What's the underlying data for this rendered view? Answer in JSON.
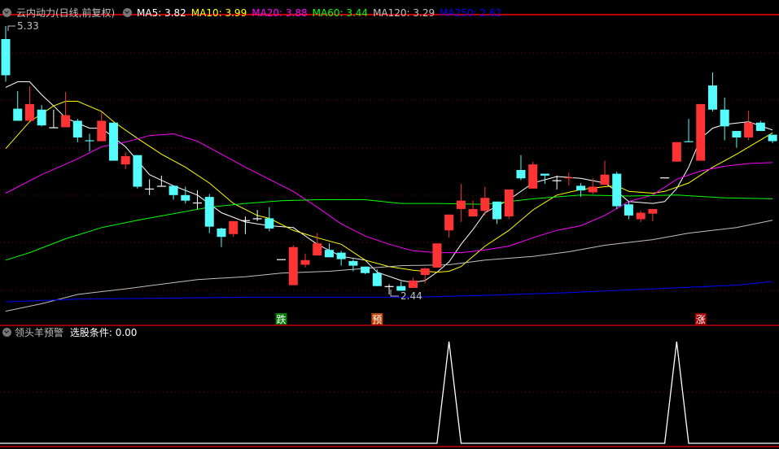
{
  "header": {
    "title": "云内动力(日线,前复权)",
    "ma_labels": [
      {
        "text": "MA5: 3.82",
        "color": "#ffffff"
      },
      {
        "text": "MA10: 3.99",
        "color": "#ffff00"
      },
      {
        "text": "MA20: 3.88",
        "color": "#ff00ff"
      },
      {
        "text": "MA60: 3.44",
        "color": "#00ff00"
      },
      {
        "text": "MA120: 3.29",
        "color": "#c0c0c0"
      },
      {
        "text": "MA250: 2.62",
        "color": "#0000ff"
      }
    ]
  },
  "indicator": {
    "name": "领头羊预警",
    "value_label": "选股条件: 0.00"
  },
  "chart_data": [
    {
      "type": "candlestick",
      "title": "云内动力(日线,前复权)",
      "price_range": [
        2.44,
        5.33
      ],
      "annotations": {
        "max_label": "5.33",
        "min_label": "2.44"
      },
      "colors": {
        "up": "#ff3333",
        "down": "#54fcfc",
        "doji": "#ffffff"
      },
      "ohlc": [
        [
          5.19,
          5.33,
          4.73,
          4.8
        ],
        [
          4.44,
          4.63,
          4.31,
          4.31
        ],
        [
          4.31,
          4.68,
          4.31,
          4.49
        ],
        [
          4.43,
          4.48,
          4.25,
          4.26
        ],
        [
          4.24,
          4.43,
          4.24,
          4.24
        ],
        [
          4.24,
          4.62,
          4.24,
          4.37
        ],
        [
          4.31,
          4.33,
          4.08,
          4.13
        ],
        [
          4.1,
          4.17,
          3.98,
          4.09
        ],
        [
          4.09,
          4.4,
          4.09,
          4.31
        ],
        [
          4.29,
          4.29,
          3.88,
          3.88
        ],
        [
          3.84,
          3.97,
          3.79,
          3.93
        ],
        [
          3.94,
          3.94,
          3.58,
          3.6
        ],
        [
          3.58,
          3.68,
          3.51,
          3.58
        ],
        [
          3.61,
          3.72,
          3.61,
          3.61
        ],
        [
          3.61,
          3.61,
          3.46,
          3.51
        ],
        [
          3.51,
          3.6,
          3.42,
          3.45
        ],
        [
          3.43,
          3.56,
          3.36,
          3.43
        ],
        [
          3.49,
          3.52,
          3.1,
          3.17
        ],
        [
          3.15,
          3.16,
          2.95,
          3.06
        ],
        [
          3.09,
          3.23,
          3.06,
          3.23
        ],
        [
          3.24,
          3.28,
          3.09,
          3.24
        ],
        [
          3.26,
          3.35,
          3.23,
          3.26
        ],
        [
          3.26,
          3.38,
          3.12,
          3.15
        ],
        [
          2.82,
          2.82,
          2.82,
          2.82
        ],
        [
          2.54,
          2.97,
          2.54,
          2.95
        ],
        [
          2.76,
          2.88,
          2.73,
          2.81
        ],
        [
          2.86,
          3.1,
          2.86,
          2.99
        ],
        [
          2.92,
          2.99,
          2.84,
          2.84
        ],
        [
          2.89,
          2.91,
          2.75,
          2.82
        ],
        [
          2.8,
          2.82,
          2.69,
          2.75
        ],
        [
          2.74,
          2.74,
          2.66,
          2.67
        ],
        [
          2.67,
          2.71,
          2.53,
          2.53
        ],
        [
          2.53,
          2.55,
          2.44,
          2.53
        ],
        [
          2.53,
          2.58,
          2.48,
          2.48
        ],
        [
          2.51,
          2.62,
          2.51,
          2.59
        ],
        [
          2.65,
          2.73,
          2.56,
          2.72
        ],
        [
          2.73,
          2.99,
          2.73,
          2.99
        ],
        [
          3.13,
          3.3,
          3.05,
          3.3
        ],
        [
          3.36,
          3.63,
          3.22,
          3.45
        ],
        [
          3.28,
          3.45,
          3.28,
          3.36
        ],
        [
          3.34,
          3.6,
          3.29,
          3.48
        ],
        [
          3.44,
          3.44,
          3.2,
          3.25
        ],
        [
          3.28,
          3.57,
          3.25,
          3.57
        ],
        [
          3.78,
          3.94,
          3.67,
          3.69
        ],
        [
          3.58,
          3.87,
          3.58,
          3.84
        ],
        [
          3.74,
          3.74,
          3.63,
          3.72
        ],
        [
          3.67,
          3.72,
          3.57,
          3.67
        ],
        [
          3.69,
          3.75,
          3.61,
          3.7
        ],
        [
          3.61,
          3.64,
          3.49,
          3.56
        ],
        [
          3.54,
          3.69,
          3.52,
          3.6
        ],
        [
          3.62,
          3.88,
          3.62,
          3.73
        ],
        [
          3.74,
          3.76,
          3.36,
          3.39
        ],
        [
          3.41,
          3.45,
          3.25,
          3.29
        ],
        [
          3.25,
          3.34,
          3.22,
          3.32
        ],
        [
          3.31,
          3.36,
          3.23,
          3.36
        ],
        [
          3.7,
          3.7,
          3.7,
          3.7
        ],
        [
          3.87,
          4.08,
          3.87,
          4.08
        ],
        [
          4.09,
          4.33,
          4.08,
          4.08
        ],
        [
          3.88,
          4.49,
          3.88,
          4.49
        ],
        [
          4.69,
          4.83,
          4.41,
          4.43
        ],
        [
          4.43,
          4.56,
          4.1,
          4.25
        ],
        [
          4.2,
          4.2,
          4.02,
          4.13
        ],
        [
          4.13,
          4.42,
          4.1,
          4.29
        ],
        [
          4.29,
          4.31,
          4.2,
          4.2
        ],
        [
          4.16,
          4.16,
          4.07,
          4.09
        ]
      ],
      "moving_averages": [
        {
          "name": "MA5",
          "color": "#ffffff",
          "points": [
            [
              0,
              4.67
            ],
            [
              1,
              4.73
            ],
            [
              2,
              4.73
            ],
            [
              3,
              4.59
            ],
            [
              4,
              4.47
            ],
            [
              5,
              4.34
            ],
            [
              7,
              4.23
            ],
            [
              8,
              4.23
            ],
            [
              10,
              4.03
            ],
            [
              12,
              3.73
            ],
            [
              14,
              3.61
            ],
            [
              16,
              3.51
            ],
            [
              18,
              3.32
            ],
            [
              20,
              3.22
            ],
            [
              22,
              3.18
            ],
            [
              24,
              3.16
            ],
            [
              26,
              2.98
            ],
            [
              28,
              2.85
            ],
            [
              30,
              2.81
            ],
            [
              31,
              2.68
            ],
            [
              33,
              2.59
            ],
            [
              34,
              2.57
            ],
            [
              35,
              2.59
            ],
            [
              36,
              2.68
            ],
            [
              37,
              2.79
            ],
            [
              38,
              2.98
            ],
            [
              39,
              3.14
            ],
            [
              40,
              3.32
            ],
            [
              42,
              3.46
            ],
            [
              44,
              3.64
            ],
            [
              46,
              3.71
            ],
            [
              48,
              3.69
            ],
            [
              50,
              3.64
            ],
            [
              51,
              3.55
            ],
            [
              52,
              3.44
            ],
            [
              54,
              3.42
            ],
            [
              55,
              3.44
            ],
            [
              56,
              3.58
            ],
            [
              57,
              3.81
            ],
            [
              58,
              4.12
            ],
            [
              59,
              4.23
            ],
            [
              60,
              4.27
            ],
            [
              62,
              4.3
            ],
            [
              64,
              4.21
            ]
          ]
        },
        {
          "name": "MA10",
          "color": "#ffff00",
          "points": [
            [
              0,
              4.01
            ],
            [
              2,
              4.3
            ],
            [
              4,
              4.47
            ],
            [
              5,
              4.52
            ],
            [
              6,
              4.52
            ],
            [
              8,
              4.41
            ],
            [
              9,
              4.3
            ],
            [
              11,
              4.12
            ],
            [
              13,
              3.95
            ],
            [
              15,
              3.81
            ],
            [
              17,
              3.64
            ],
            [
              19,
              3.42
            ],
            [
              21,
              3.29
            ],
            [
              22,
              3.26
            ],
            [
              24,
              3.13
            ],
            [
              26,
              3.05
            ],
            [
              28,
              2.98
            ],
            [
              30,
              2.81
            ],
            [
              32,
              2.74
            ],
            [
              34,
              2.7
            ],
            [
              36,
              2.68
            ],
            [
              37,
              2.69
            ],
            [
              38,
              2.74
            ],
            [
              39,
              2.85
            ],
            [
              40,
              2.96
            ],
            [
              42,
              3.13
            ],
            [
              44,
              3.35
            ],
            [
              46,
              3.51
            ],
            [
              48,
              3.57
            ],
            [
              50,
              3.6
            ],
            [
              51,
              3.61
            ],
            [
              52,
              3.55
            ],
            [
              54,
              3.53
            ],
            [
              55,
              3.55
            ],
            [
              57,
              3.64
            ],
            [
              59,
              3.81
            ],
            [
              61,
              3.95
            ],
            [
              64,
              4.18
            ]
          ]
        },
        {
          "name": "MA20",
          "color": "#ff00ff",
          "points": [
            [
              0,
              3.53
            ],
            [
              3,
              3.73
            ],
            [
              6,
              3.9
            ],
            [
              8,
              4.03
            ],
            [
              10,
              4.08
            ],
            [
              12,
              4.15
            ],
            [
              14,
              4.17
            ],
            [
              16,
              4.09
            ],
            [
              18,
              3.95
            ],
            [
              20,
              3.81
            ],
            [
              22,
              3.68
            ],
            [
              24,
              3.55
            ],
            [
              26,
              3.38
            ],
            [
              28,
              3.2
            ],
            [
              30,
              3.07
            ],
            [
              32,
              2.98
            ],
            [
              34,
              2.91
            ],
            [
              36,
              2.89
            ],
            [
              38,
              2.89
            ],
            [
              40,
              2.92
            ],
            [
              42,
              2.96
            ],
            [
              44,
              3.05
            ],
            [
              46,
              3.13
            ],
            [
              48,
              3.18
            ],
            [
              50,
              3.29
            ],
            [
              52,
              3.44
            ],
            [
              54,
              3.51
            ],
            [
              56,
              3.68
            ],
            [
              58,
              3.77
            ],
            [
              60,
              3.82
            ],
            [
              62,
              3.85
            ],
            [
              64,
              3.86
            ]
          ]
        },
        {
          "name": "MA60",
          "color": "#00ff00",
          "points": [
            [
              0,
              2.81
            ],
            [
              2,
              2.89
            ],
            [
              5,
              3.04
            ],
            [
              8,
              3.16
            ],
            [
              11,
              3.24
            ],
            [
              14,
              3.31
            ],
            [
              17,
              3.38
            ],
            [
              20,
              3.42
            ],
            [
              23,
              3.45
            ],
            [
              26,
              3.46
            ],
            [
              30,
              3.46
            ],
            [
              33,
              3.42
            ],
            [
              36,
              3.42
            ],
            [
              40,
              3.41
            ],
            [
              44,
              3.47
            ],
            [
              48,
              3.51
            ],
            [
              52,
              3.5
            ],
            [
              56,
              3.51
            ],
            [
              60,
              3.48
            ],
            [
              64,
              3.47
            ]
          ]
        },
        {
          "name": "MA120",
          "color": "#c0c0c0",
          "points": [
            [
              0,
              2.26
            ],
            [
              3,
              2.34
            ],
            [
              6,
              2.44
            ],
            [
              10,
              2.5
            ],
            [
              13,
              2.55
            ],
            [
              16,
              2.6
            ],
            [
              20,
              2.63
            ],
            [
              23,
              2.67
            ],
            [
              27,
              2.69
            ],
            [
              30,
              2.72
            ],
            [
              33,
              2.75
            ],
            [
              37,
              2.76
            ],
            [
              40,
              2.81
            ],
            [
              44,
              2.85
            ],
            [
              47,
              2.9
            ],
            [
              50,
              2.97
            ],
            [
              54,
              3.03
            ],
            [
              57,
              3.1
            ],
            [
              61,
              3.16
            ],
            [
              64,
              3.24
            ]
          ]
        },
        {
          "name": "MA250",
          "color": "#0000ff",
          "points": [
            [
              0,
              2.36
            ],
            [
              6,
              2.39
            ],
            [
              13,
              2.4
            ],
            [
              20,
              2.41
            ],
            [
              27,
              2.41
            ],
            [
              34,
              2.41
            ],
            [
              40,
              2.43
            ],
            [
              47,
              2.46
            ],
            [
              54,
              2.5
            ],
            [
              61,
              2.54
            ],
            [
              64,
              2.58
            ]
          ]
        }
      ],
      "signals": [
        {
          "index": 23,
          "text": "跌",
          "color": "#008000"
        },
        {
          "index": 31,
          "text": "预",
          "color": "#c04000"
        },
        {
          "index": 58,
          "text": "涨",
          "color": "#a00000"
        }
      ]
    },
    {
      "type": "line",
      "title": "领头羊预警",
      "ylim": [
        0,
        1
      ],
      "series": [
        {
          "name": "选股条件",
          "color": "#ffffff",
          "nonzero": [
            [
              37,
              1
            ],
            [
              56,
              1
            ]
          ],
          "length": 65
        }
      ]
    }
  ]
}
